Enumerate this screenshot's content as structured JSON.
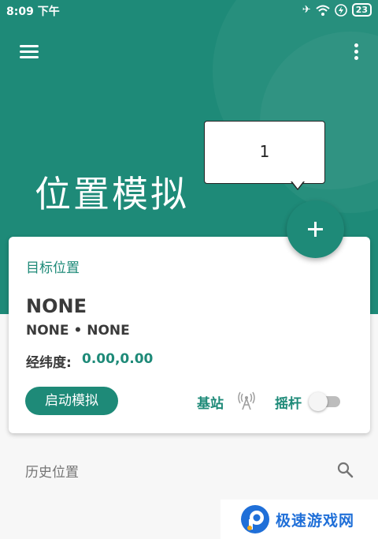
{
  "status_bar": {
    "time": "8:09 下午",
    "battery": "23"
  },
  "header": {
    "title": "位置模拟"
  },
  "tooltip": {
    "text": "1"
  },
  "card": {
    "section_label": "目标位置",
    "place_name": "NONE",
    "place_sub": "NONE • NONE",
    "coord_label": "经纬度:",
    "coord_value": "0.00,0.00",
    "start_button": "启动模拟",
    "base_station_label": "基站",
    "joystick_label": "摇杆",
    "joystick_enabled": false
  },
  "history": {
    "label": "历史位置"
  },
  "watermark": {
    "text": "极速游戏网"
  },
  "colors": {
    "primary": "#1e8a78",
    "background": "#f7f7f7",
    "watermark_blue": "#1f6fd8"
  }
}
